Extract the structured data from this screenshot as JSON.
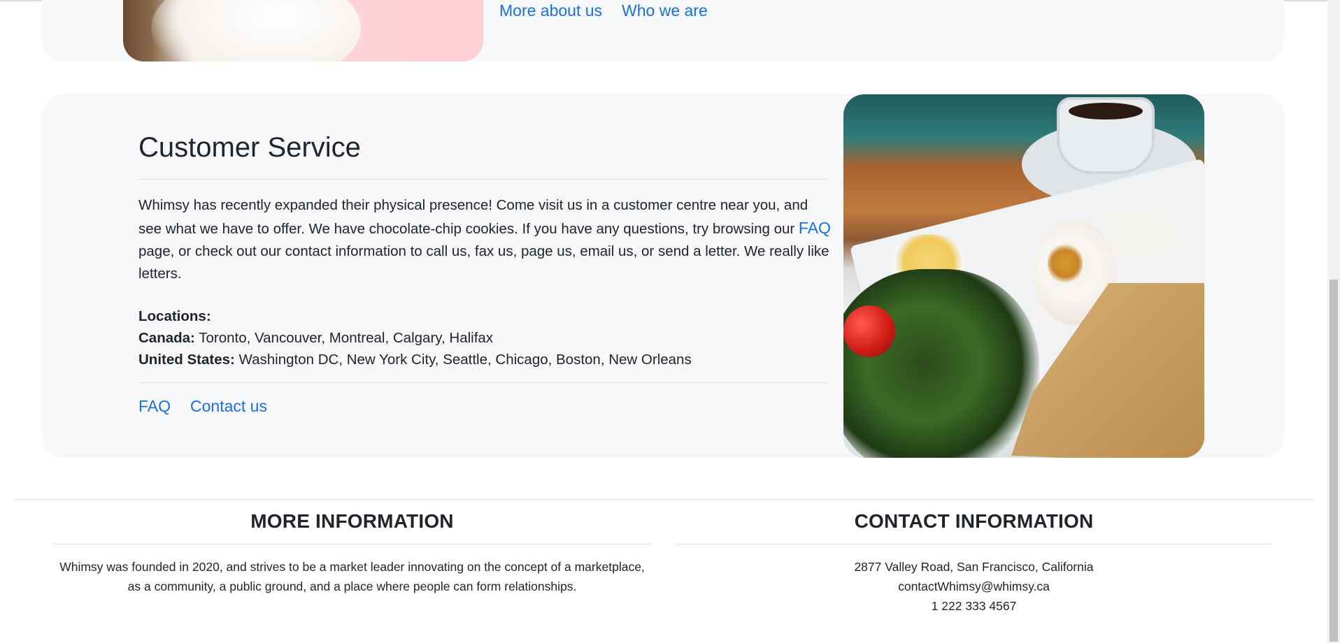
{
  "about_card": {
    "links": [
      "More about us",
      "Who we are"
    ]
  },
  "customer_service": {
    "title": "Customer Service",
    "paragraph_before_link": "Whimsy has recently expanded their physical presence! Come visit us in a customer centre near you, and see what we have to offer. We have chocolate-chip cookies. If you have any questions, try browsing our ",
    "inline_link": "FAQ",
    "paragraph_after_link": " page, or check out our contact information to call us, fax us, page us, email us, or send a letter. We really like letters.",
    "locations_heading": "Locations:",
    "locations": [
      {
        "country": "Canada:",
        "cities": " Toronto, Vancouver, Montreal, Calgary, Halifax"
      },
      {
        "country": "United States:",
        "cities": " Washington DC, New York City, Seattle, Chicago, Boston, New Orleans"
      }
    ],
    "links": [
      "FAQ",
      "Contact us"
    ]
  },
  "footer": {
    "more_info": {
      "heading": "MORE INFORMATION",
      "text": "Whimsy was founded in 2020, and strives to be a market leader innovating on the concept of a marketplace, as a community, a public ground, and a place where people can form relationships."
    },
    "contact_info": {
      "heading": "CONTACT INFORMATION",
      "address": "2877 Valley Road, San Francisco, California",
      "email": "contactWhimsy@whimsy.ca",
      "phone": "1 222 333 4567"
    }
  },
  "colors": {
    "link": "#1a6fe0",
    "card_background": "#f7f8f9",
    "text": "#212529"
  }
}
